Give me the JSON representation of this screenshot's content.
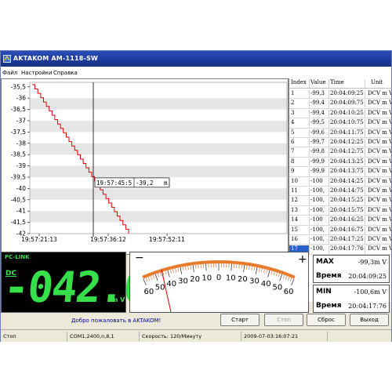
{
  "window": {
    "title": "AKTAKOM AM-1118-SW"
  },
  "menu": [
    "Файл",
    "Настройки",
    "Справка"
  ],
  "chart_data": {
    "type": "line",
    "y_ticks": [
      "-35,5",
      "-36",
      "-36,5",
      "-37",
      "-37,5",
      "-38",
      "-38,5",
      "-39",
      "-39,5",
      "-40",
      "-40,5",
      "-41",
      "-41,5",
      "-42"
    ],
    "ylim": [
      -42,
      -35.3
    ],
    "x_ticks": [
      "19:57:21:13",
      "19:57:36:12",
      "19:57:52:11"
    ],
    "series": [
      {
        "values": [
          -35.4,
          -42.0
        ]
      }
    ],
    "cursor_readout": {
      "time": "19:57:45:5",
      "value": "-39,2",
      "unit": "m"
    }
  },
  "table": {
    "headers": [
      "Index",
      "Value",
      "Time",
      "Unit"
    ],
    "rows": [
      [
        "1",
        "-99,3",
        "20:04:09:25",
        "DCV m V"
      ],
      [
        "2",
        "-99,4",
        "20:04:09:75",
        "DCV m V"
      ],
      [
        "3",
        "-99,4",
        "20:04:10:25",
        "DCV m V"
      ],
      [
        "4",
        "-99,5",
        "20:04:10:75",
        "DCV m V"
      ],
      [
        "5",
        "-99,6",
        "20:04:11:75",
        "DCV m V"
      ],
      [
        "6",
        "-99,7",
        "20:04:12:25",
        "DCV m V"
      ],
      [
        "7",
        "-99,8",
        "20:04:12:75",
        "DCV m V"
      ],
      [
        "8",
        "-99,9",
        "20:04:13:25",
        "DCV m V"
      ],
      [
        "9",
        "-99,9",
        "20:04:13:75",
        "DCV m V"
      ],
      [
        "10",
        "-100",
        "20:04:14:25",
        "DCV m V"
      ],
      [
        "11",
        "-100,",
        "20:04:14:75",
        "DCV m V"
      ],
      [
        "12",
        "-100,",
        "20:04:15:25",
        "DCV m V"
      ],
      [
        "13",
        "-100,",
        "20:04:15:75",
        "DCV m V"
      ],
      [
        "14",
        "-100",
        "20:04:16:25",
        "DCV m V"
      ],
      [
        "15",
        "-100,",
        "20:04:16:75",
        "DCV m V"
      ],
      [
        "16",
        "-100,",
        "20:04:17:25",
        "DCV m V"
      ],
      [
        "17",
        "-100,",
        "20:04:17:76",
        "DCV m V"
      ]
    ],
    "selected_index": 16
  },
  "lcd": {
    "link": "PC-LINK",
    "mode": "DC",
    "value": "-042.0",
    "unit": "m V",
    "color": "#36e04a"
  },
  "meter": {
    "labels": [
      "60",
      "50",
      "40",
      "30",
      "20",
      "10",
      "0",
      "10",
      "20",
      "30",
      "40",
      "50",
      "60"
    ],
    "minus": "−",
    "plus": "+"
  },
  "max": {
    "label": "MAX",
    "value": "-99,3m V",
    "time_label": "Время",
    "time": "20:04:09:25"
  },
  "min": {
    "label": "MIN",
    "value": "-100,6m V",
    "time_label": "Время",
    "time": "20:04:17:76"
  },
  "welcome": "Добро пожаловать в AKTAKOM!",
  "buttons": {
    "start": "Старт",
    "stop": "Стоп",
    "reset": "Сброс",
    "exit": "Выход"
  },
  "status": {
    "state": "Стоп",
    "port": "COM1,2400,n,8,1",
    "speed": "Скорость: 120/Минуту",
    "datetime": "2009-07-03:16:07:21"
  }
}
